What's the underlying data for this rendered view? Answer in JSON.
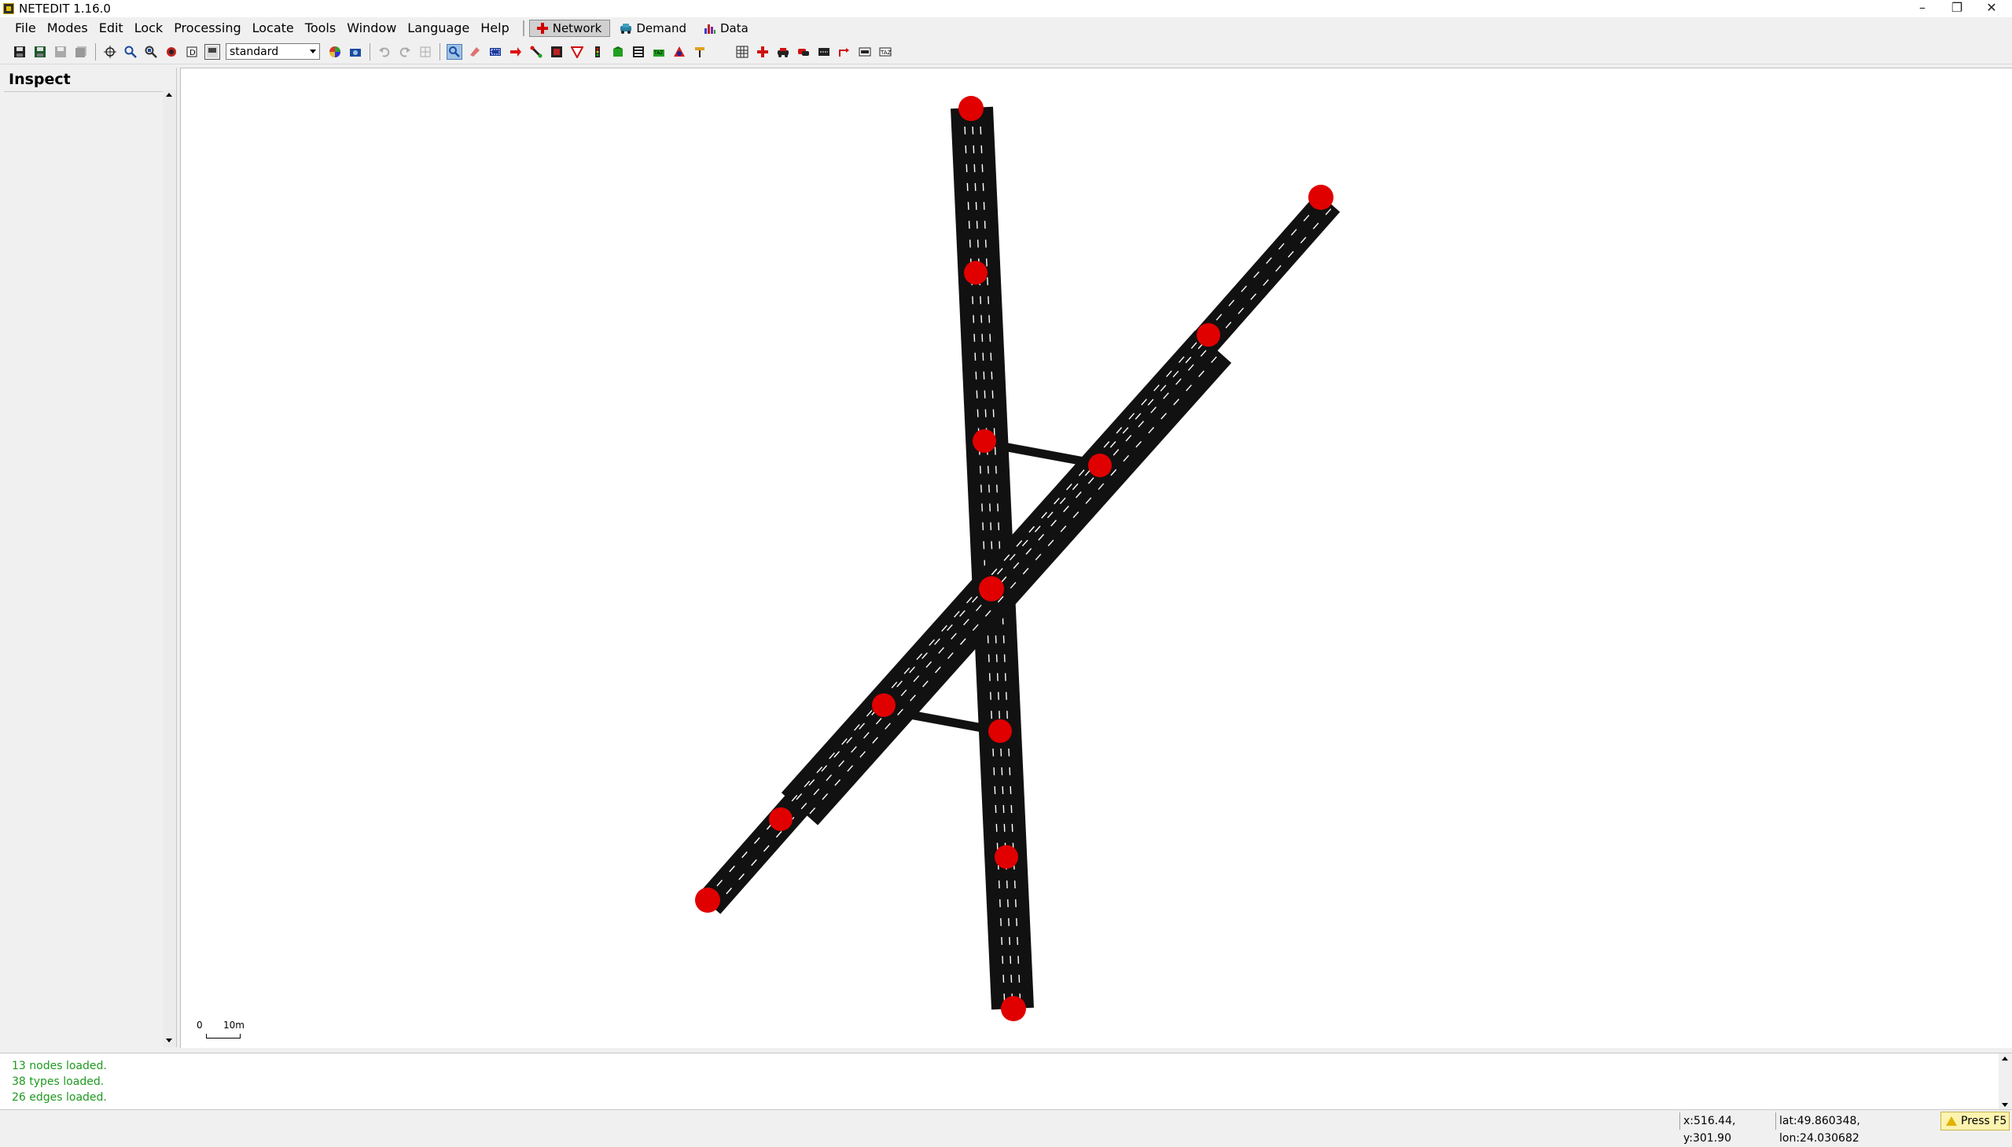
{
  "window": {
    "title": "NETEDIT 1.16.0",
    "minimize": "–",
    "restore": "❐",
    "close": "✕"
  },
  "menu": {
    "items": [
      "File",
      "Modes",
      "Edit",
      "Lock",
      "Processing",
      "Locate",
      "Tools",
      "Window",
      "Language",
      "Help"
    ],
    "modes": [
      {
        "label": "Network",
        "active": true
      },
      {
        "label": "Demand",
        "active": false
      },
      {
        "label": "Data",
        "active": false
      }
    ]
  },
  "toolbar": {
    "scheme_value": "standard"
  },
  "panel": {
    "title": "Inspect"
  },
  "canvas": {
    "scale_zero": "0",
    "scale_ten": "10m",
    "road_color": "#111111",
    "node_color": "#e00000"
  },
  "messages": {
    "lines": [
      "13 nodes loaded.",
      "38 types loaded.",
      "26 edges loaded."
    ],
    "color": "#1f9a1f"
  },
  "status": {
    "xy": "x:516.44, y:301.90",
    "latlon": "lat:49.860348, lon:24.030682",
    "f5_label": "Press F5"
  }
}
